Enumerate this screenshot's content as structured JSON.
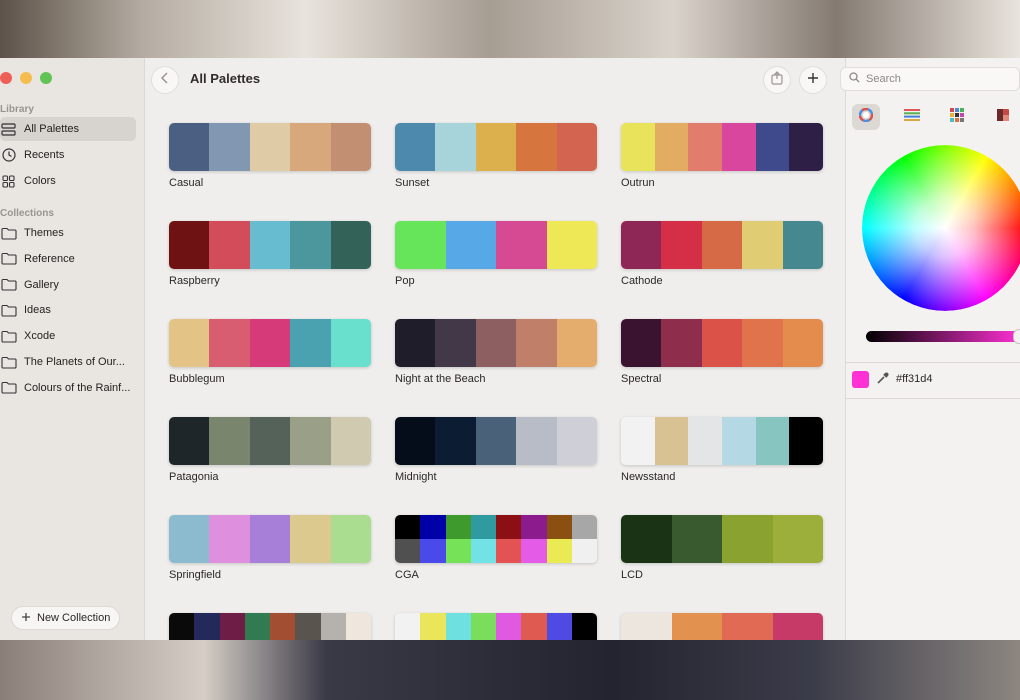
{
  "window": {
    "title": "All Palettes"
  },
  "sidebar": {
    "library_heading": "Library",
    "library_items": [
      {
        "label": "All Palettes",
        "icon": "palettes-icon",
        "active": true
      },
      {
        "label": "Recents",
        "icon": "clock-icon",
        "active": false
      },
      {
        "label": "Colors",
        "icon": "grid-icon",
        "active": false
      }
    ],
    "collections_heading": "Collections",
    "collections": [
      {
        "label": "Themes",
        "icon": "folder-icon"
      },
      {
        "label": "Reference",
        "icon": "folder-icon"
      },
      {
        "label": "Gallery",
        "icon": "folder-icon"
      },
      {
        "label": "Ideas",
        "icon": "folder-icon"
      },
      {
        "label": "Xcode",
        "icon": "folder-icon"
      },
      {
        "label": "The Planets of Our...",
        "icon": "folder-icon"
      },
      {
        "label": "Colours of the Rainf...",
        "icon": "folder-icon"
      }
    ],
    "new_collection_label": "New Collection"
  },
  "toolbar": {
    "back_icon": "chevron-left-icon",
    "export_icon": "export-icon",
    "add_icon": "plus-icon"
  },
  "search": {
    "placeholder": "Search"
  },
  "palettes": [
    {
      "name": "Casual",
      "colors": [
        "#4b5f82",
        "#8297b2",
        "#dfcba6",
        "#d7a87b",
        "#c38f73"
      ]
    },
    {
      "name": "Sunset",
      "colors": [
        "#4d88ad",
        "#a7d4da",
        "#dcb04c",
        "#d6753d",
        "#d26450"
      ]
    },
    {
      "name": "Outrun",
      "colors": [
        "#e8e35a",
        "#e2ad62",
        "#e27d6e",
        "#d8469d",
        "#3e4a8c",
        "#2d1f45"
      ]
    },
    {
      "name": "Raspberry",
      "colors": [
        "#6e1214",
        "#d24c5a",
        "#67bccf",
        "#4b979d",
        "#336358"
      ]
    },
    {
      "name": "Pop",
      "colors": [
        "#66e55a",
        "#56a8e6",
        "#d64a93",
        "#eee856"
      ]
    },
    {
      "name": "Cathode",
      "colors": [
        "#8f2756",
        "#d42f47",
        "#d76a46",
        "#e0cc73",
        "#46888f"
      ]
    },
    {
      "name": "Bubblegum",
      "colors": [
        "#e3c386",
        "#d85d70",
        "#d73a78",
        "#4aa2b1",
        "#69e0ce"
      ]
    },
    {
      "name": "Night at the Beach",
      "colors": [
        "#1f1d2a",
        "#433848",
        "#8d5f60",
        "#c07f68",
        "#e5ad6d"
      ]
    },
    {
      "name": "Spectral",
      "colors": [
        "#3a1331",
        "#8f2d4d",
        "#db5348",
        "#e0724c",
        "#e48b4e"
      ]
    },
    {
      "name": "Patagonia",
      "colors": [
        "#1e2629",
        "#79856d",
        "#55625a",
        "#9aa087",
        "#d0cbb0"
      ]
    },
    {
      "name": "Midnight",
      "colors": [
        "#040d19",
        "#0c1c32",
        "#4a6279",
        "#b8bcc7",
        "#cfd0d7"
      ]
    },
    {
      "name": "Newsstand",
      "colors": [
        "#f2f2f2",
        "#d8c192",
        "#e4e5e6",
        "#b4d8e4",
        "#86c5c0",
        "#000000"
      ]
    },
    {
      "name": "Springfield",
      "colors": [
        "#8cbbcf",
        "#de90df",
        "#a87fd8",
        "#dbc98e",
        "#abdd91"
      ]
    },
    {
      "name": "CGA",
      "two_row": true,
      "colors": [
        "#000000",
        "#0000a8",
        "#3e9a2c",
        "#2f9aa0",
        "#8c0f14",
        "#8c1b8d",
        "#8a5012",
        "#a7a7a7",
        "#505050",
        "#4a4aea",
        "#76e258",
        "#72e2e6",
        "#e35354",
        "#e45be7",
        "#eaea55",
        "#f0f0f0"
      ]
    },
    {
      "name": "LCD",
      "colors": [
        "#1a3315",
        "#395a2f",
        "#8aa22f",
        "#9caf3a"
      ]
    },
    {
      "name": "",
      "colors": [
        "#0a0a0a",
        "#23295a",
        "#6e1d46",
        "#317a52",
        "#a24e33",
        "#5a544f",
        "#b5b2ae",
        "#efe7dd"
      ]
    },
    {
      "name": "",
      "colors": [
        "#f2f2f2",
        "#eae55a",
        "#6de0df",
        "#7ade5c",
        "#df5ae0",
        "#df5a51",
        "#4e4ae2",
        "#000000"
      ]
    },
    {
      "name": "",
      "colors": [
        "#ece6de",
        "#e2914f",
        "#e06a53",
        "#c63a68"
      ]
    }
  ],
  "inspector": {
    "tabs": [
      {
        "icon": "color-wheel-icon",
        "active": true
      },
      {
        "icon": "sliders-icon",
        "active": false
      },
      {
        "icon": "palette-grid-icon",
        "active": false
      },
      {
        "icon": "image-palette-icon",
        "active": false
      }
    ],
    "brightness_percent": 100,
    "current_color": "#ff31d4",
    "hex_value": "#ff31d4",
    "eyedropper_icon": "eyedropper-icon"
  }
}
